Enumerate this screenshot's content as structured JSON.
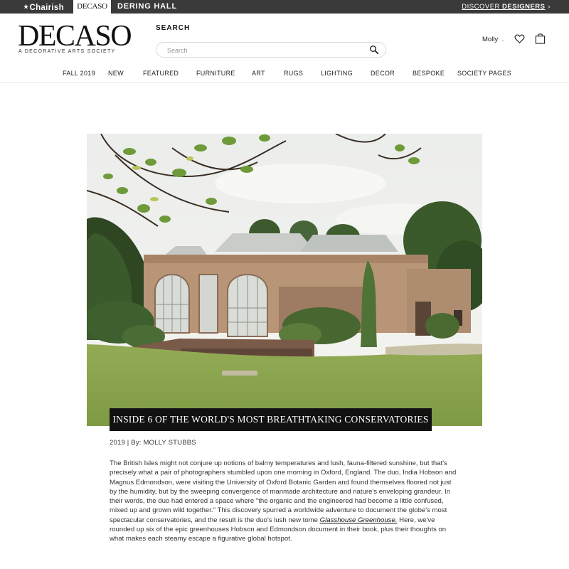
{
  "topbar": {
    "chairish": "Chairish",
    "decaso": "DECASO",
    "dering_hall": "DERING HALL",
    "discover_prefix": "DISCOVER",
    "discover_strong": "DESIGNERS",
    "discover_chevron": "›"
  },
  "header": {
    "logo": "DECASO",
    "logo_subtitle": "A DECORATIVE ARTS SOCIETY",
    "search_label": "SEARCH",
    "search_placeholder": "Search",
    "user_name": "Molly",
    "user_caret": "⌄"
  },
  "nav": {
    "items": [
      "FALL 2019",
      "NEW",
      "FEATURED",
      "FURNITURE",
      "ART",
      "RUGS",
      "LIGHTING",
      "DECOR",
      "BESPOKE",
      "SOCIETY PAGES"
    ]
  },
  "article": {
    "headline": "INSIDE 6 OF THE WORLD'S MOST BREATHTAKING CONSERVATORIES",
    "byline": "2019 | By: MOLLY STUBBS",
    "body_part1": "The British Isles might not conjure up notions of balmy temperatures and lush, fauna-filtered sunshine, but that's precisely what a pair of photographers stumbled upon one morning in Oxford, England. The duo, India Hobson and Magnus Edmondson, were visiting the University of Oxford Botanic Garden and found themselves floored not just by the humidity, but by the sweeping convergence of manmade architecture and nature's enveloping grandeur. In their words, the duo had entered a space where \"the organic and the engineered had become a little confused, mixed up and grown wild together.\" This discovery spurred a worldwide adventure to document the globe's most spectacular conservatories, and the result is the duo's lush new tome ",
    "book_title": "Glasshouse Greenhouse.",
    "body_part2": " Here, we've rounded up six of the epic greenhouses Hobson and Edmondson document in their book, plus their thoughts on what makes each steamy escape a figurative global hotspot."
  },
  "colors": {
    "topbar_bg": "#3a3a3a",
    "headline_bg": "#111111",
    "grass": "#8ea64d",
    "stone": "#b8957a"
  },
  "icons": {
    "search": "search-icon",
    "heart": "heart-icon",
    "bag": "bag-icon"
  }
}
